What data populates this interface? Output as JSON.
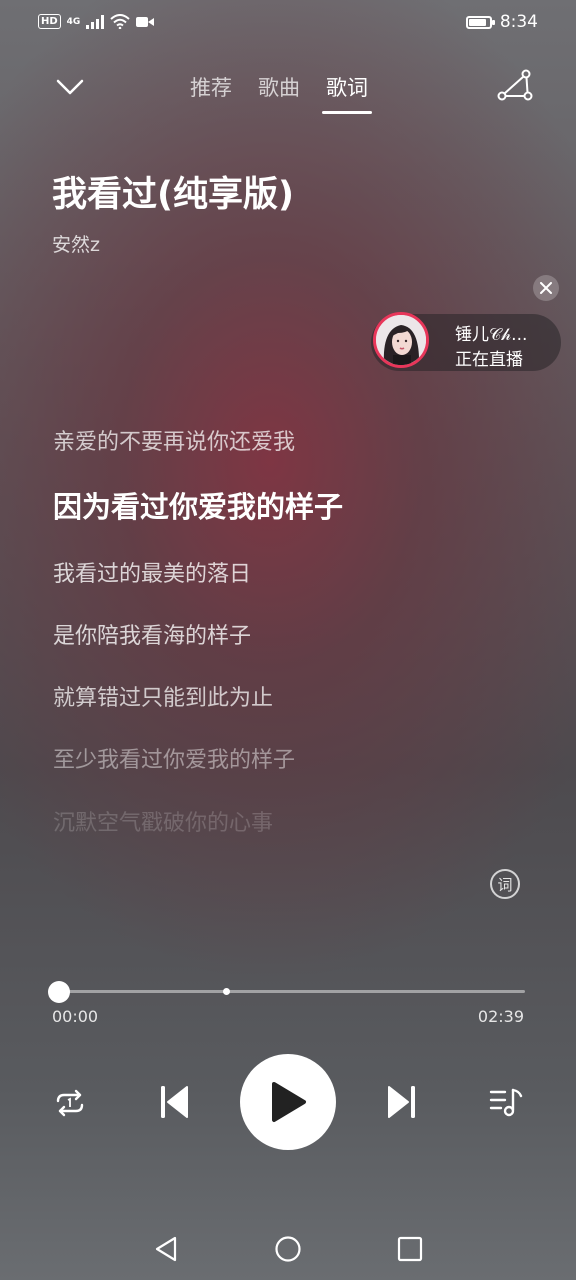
{
  "status_bar": {
    "network_label": "HD",
    "signal_label": "4G",
    "time": "8:34",
    "battery_level": 0.85
  },
  "nav": {
    "tabs": [
      {
        "label": "推荐",
        "active": false
      },
      {
        "label": "歌曲",
        "active": false
      },
      {
        "label": "歌词",
        "active": true
      }
    ]
  },
  "song": {
    "title": "我看过(纯享版)",
    "artist": "安然z"
  },
  "live": {
    "name": "锤儿𝒞𝒽...",
    "status": "正在直播"
  },
  "lyrics": [
    "亲爱的不要再说你还爱我",
    "因为看过你爱我的样子",
    "我看过的最美的落日",
    "是你陪我看海的样子",
    "就算错过只能到此为止",
    "至少我看过你爱我的样子",
    "沉默空气戳破你的心事"
  ],
  "lyrics_button_label": "词",
  "player": {
    "current_time": "00:00",
    "total_time": "02:39",
    "progress": 0.0,
    "buffered": 0.36
  },
  "colors": {
    "accent_ring": "#e8365a",
    "background_red": "#803442"
  }
}
